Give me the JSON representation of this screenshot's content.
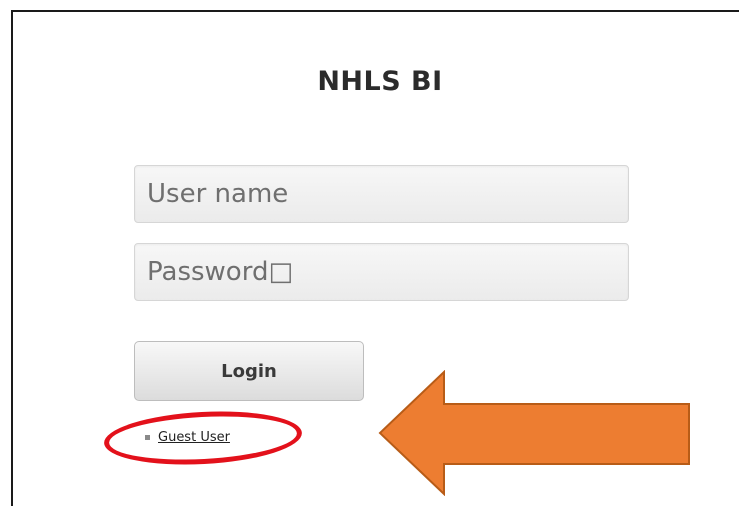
{
  "login": {
    "title": "NHLS BI",
    "username_placeholder": "User name",
    "password_placeholder": "Password□",
    "login_label": "Login",
    "guest_label": "Guest User"
  },
  "annotations": {
    "ellipse_color": "#e3111b",
    "arrow_color": "#ed7d31",
    "arrow_border_color": "#b85c17",
    "arrow_direction": "left"
  }
}
